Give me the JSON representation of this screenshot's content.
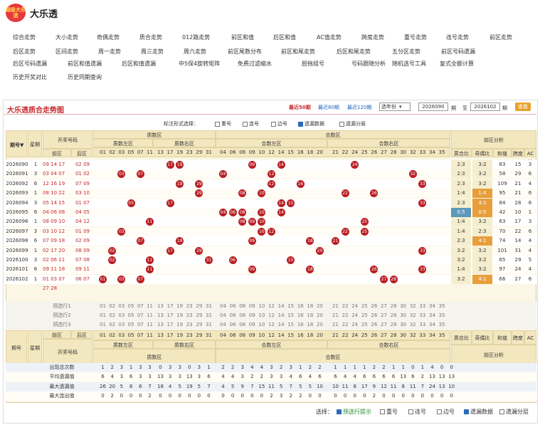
{
  "app": {
    "logo_text": "超级大乐透",
    "title": "大乐透"
  },
  "nav": {
    "row1": [
      "综合走势",
      "大小走势",
      "奇偶走势",
      "质合走势",
      "012路走势",
      "前区和值",
      "后区和值",
      "AC值走势",
      "跨度走势",
      "重号走势",
      "连号走势",
      "前区走势"
    ],
    "row2": [
      "后区走势",
      "区间走势",
      "周一走势",
      "周三走势",
      "周六走势",
      "前区尾数分布",
      "前区和尾走势",
      "后区和尾走势",
      "五分区走势",
      "前区号码遗漏"
    ],
    "row3": [
      "后区号码遗漏",
      "前区和值遗漏",
      "后区和值遗漏",
      "中5保4旋转矩阵",
      "免费过滤缩水",
      "胆拖组号",
      "号码跟随分析",
      "随机选号工具",
      "复式全额计算"
    ],
    "row4": [
      "历史开奖对比",
      "历史同期查询"
    ]
  },
  "panel": {
    "title": "大乐透质合走势图",
    "periods": [
      "最近50期",
      "最近80期",
      "最近120期"
    ],
    "select": "选年份",
    "from": "2026090",
    "to": "2026102",
    "from_label": "期",
    "to_sep": "至",
    "to_label": "期",
    "query": "查看"
  },
  "options": {
    "label": "标注形式选择：",
    "items": [
      {
        "label": "重号",
        "checked": false
      },
      {
        "label": "连号",
        "checked": false
      },
      {
        "label": "边号",
        "checked": false
      },
      {
        "label": "遗漏数据",
        "checked": true
      },
      {
        "label": "遗漏分层",
        "checked": false
      }
    ]
  },
  "headers": {
    "issue": "期号",
    "week": "星期",
    "draw": "开奖号码",
    "front": "前区",
    "back": "后区",
    "prime": "质数区",
    "prime_left": "质数左区",
    "prime_right": "质数右区",
    "composite": "合数区",
    "comp_left": "合数左区",
    "comp_right": "合数右区",
    "analysis": "前区分析",
    "ana_cols": [
      "质合比",
      "奇偶比",
      "和值",
      "跨度",
      "AC值"
    ]
  },
  "numbers": {
    "prime_left": [
      "01",
      "02",
      "03",
      "05",
      "07",
      "11"
    ],
    "prime_right": [
      "13",
      "17",
      "19",
      "23",
      "29",
      "31"
    ],
    "comp_left": [
      "04",
      "06",
      "08",
      "09",
      "10",
      "12",
      "14",
      "15",
      "16",
      "18",
      "20"
    ],
    "comp_right": [
      "21",
      "22",
      "24",
      "25",
      "26",
      "27",
      "28",
      "30",
      "32",
      "33",
      "34",
      "35"
    ]
  },
  "draws": [
    {
      "issue": "2026090",
      "week": "1",
      "front": "09 14 17 19 24",
      "back": "02 09",
      "ratio": "2:3",
      "oe": "3:2",
      "sum": "83",
      "span": "15",
      "ac": "3"
    },
    {
      "issue": "2026091",
      "week": "3",
      "front": "03 04 07 12 32",
      "back": "01 02",
      "ratio": "2:3",
      "oe": "3:2",
      "sum": "58",
      "span": "29",
      "ac": "6"
    },
    {
      "issue": "2026092",
      "week": "6",
      "front": "12 16 19 29 33",
      "back": "07 09",
      "ratio": "2:3",
      "oe": "3:2",
      "sum": "109",
      "span": "21",
      "ac": "4"
    },
    {
      "issue": "2026093",
      "week": "1",
      "front": "08 10 22 26 29",
      "back": "03 10",
      "ratio": "1:4",
      "oe": "1:4",
      "sum": "95",
      "span": "21",
      "ac": "6"
    },
    {
      "issue": "2026094",
      "week": "3",
      "front": "05 14 15 17 33",
      "back": "01 07",
      "ratio": "2:3",
      "oe": "4:1",
      "sum": "84",
      "span": "28",
      "ac": "6"
    },
    {
      "issue": "2026095",
      "week": "6",
      "front": "04 06 08 10 14",
      "back": "04 05",
      "ratio": "0:5",
      "oe": "0:5",
      "sum": "42",
      "span": "10",
      "ac": "1"
    },
    {
      "issue": "2026096",
      "week": "1",
      "front": "08 09 10 11 25",
      "back": "04 12",
      "ratio": "1:4",
      "oe": "3:2",
      "sum": "63",
      "span": "17",
      "ac": "3"
    },
    {
      "issue": "2026097",
      "week": "3",
      "front": "03 10 12 22 25",
      "back": "01 09",
      "ratio": "1:4",
      "oe": "2:3",
      "sum": "70",
      "span": "22",
      "ac": "6"
    },
    {
      "issue": "2026098",
      "week": "6",
      "front": "07 09 18 19 21",
      "back": "02 09",
      "ratio": "2:3",
      "oe": "4:1",
      "sum": "74",
      "span": "14",
      "ac": "4"
    },
    {
      "issue": "2026099",
      "week": "1",
      "front": "02 17 20 29 33",
      "back": "08 09",
      "ratio": "3:2",
      "oe": "3:2",
      "sum": "101",
      "span": "31",
      "ac": "4"
    },
    {
      "issue": "2026100",
      "week": "3",
      "front": "02 06 11 15 31",
      "back": "07 08",
      "ratio": "3:2",
      "oe": "3:2",
      "sum": "65",
      "span": "29",
      "ac": "5"
    },
    {
      "issue": "2026101",
      "week": "6",
      "front": "09 11 18 26 33",
      "back": "09 11",
      "ratio": "1:4",
      "oe": "3:2",
      "sum": "97",
      "span": "24",
      "ac": "4"
    },
    {
      "issue": "2026102",
      "week": "1",
      "front": "01 03 07 27 28",
      "back": "06 07",
      "ratio": "3:2",
      "oe": "4:1",
      "sum": "66",
      "span": "27",
      "ac": "6"
    }
  ],
  "preselect": [
    "预选行1",
    "预选行2",
    "预选行3"
  ],
  "stats": {
    "labels": [
      "出现总次数",
      "平均遗漏值",
      "最大遗漏值",
      "最大连出值"
    ],
    "rows": [
      [
        "1",
        "2",
        "3",
        "1",
        "3",
        "3",
        "0",
        "3",
        "3",
        "0",
        "3",
        "1",
        "2",
        "2",
        "3",
        "4",
        "4",
        "3",
        "2",
        "3",
        "1",
        "2",
        "2",
        "1",
        "1",
        "1",
        "1",
        "2",
        "2",
        "1",
        "1",
        "0",
        "1",
        "4",
        "0",
        "0"
      ],
      [
        "6",
        "4",
        "3",
        "6",
        "3",
        "3",
        "13",
        "3",
        "3",
        "13",
        "3",
        "6",
        "4",
        "4",
        "3",
        "2",
        "2",
        "3",
        "3",
        "4",
        "6",
        "4",
        "6",
        "6",
        "4",
        "4",
        "6",
        "6",
        "6",
        "6",
        "13",
        "6",
        "2",
        "13",
        "13",
        "13"
      ],
      [
        "26",
        "20",
        "5",
        "8",
        "6",
        "7",
        "18",
        "4",
        "5",
        "19",
        "5",
        "7",
        "4",
        "5",
        "9",
        "7",
        "15",
        "11",
        "5",
        "7",
        "5",
        "5",
        "10",
        "10",
        "11",
        "8",
        "17",
        "9",
        "12",
        "11",
        "8",
        "11",
        "7",
        "24",
        "13",
        "10"
      ],
      [
        "0",
        "2",
        "0",
        "0",
        "0",
        "2",
        "0",
        "0",
        "0",
        "0",
        "0",
        "0",
        "0",
        "0",
        "0",
        "0",
        "0",
        "2",
        "3",
        "2",
        "2",
        "0",
        "0",
        "0",
        "0",
        "0",
        "0",
        "2",
        "0",
        "0",
        "0",
        "0",
        "0",
        "0",
        "0",
        "0"
      ]
    ]
  },
  "footer": {
    "label": "选择：",
    "items": [
      {
        "label": "预选行提示",
        "checked": true
      },
      {
        "label": "重号",
        "checked": false
      },
      {
        "label": "连号",
        "checked": false
      },
      {
        "label": "边号",
        "checked": false
      },
      {
        "label": "遗漏数据",
        "checked": true
      },
      {
        "label": "遗漏分层",
        "checked": false
      }
    ]
  },
  "colors": {
    "accent": "#c9282d",
    "ball": "#b81e24",
    "header": "#f3e7bf"
  }
}
